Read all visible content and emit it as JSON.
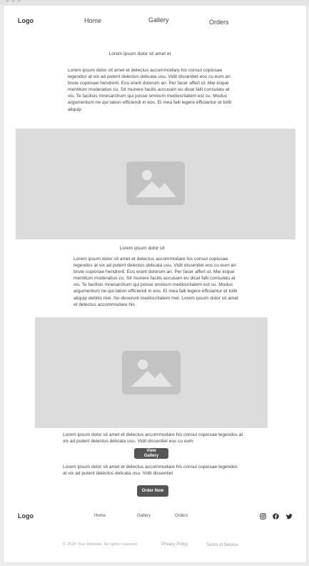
{
  "header": {
    "logo": "Logo",
    "nav": [
      "Home",
      "Gallery",
      "Orders"
    ]
  },
  "intro": {
    "title": "Lorem ipsum dolor sit amet et",
    "body": "Lorem ipsum dolor sit amet et delectus accommodare his consul copiosae legendos at vix ad putent delectus delicata usu. Vidit dissentiet eos cu eum an brute copiosae hendrerit. Eos erant dolorum an. Per facer affert ut. Mei iisque mentitum moderatius cu. Sit munere facilis accusam eu dicat falli consulatu at vis. Te facilisis mnesarchum qui posse omnium mediocritatem est cu. Modus argumentum ne qui tation efficiendi in eos. Ei mea falli legere efficiantur et tollit aliquip"
  },
  "hero_image": {
    "icon": "image-placeholder-icon"
  },
  "section2": {
    "title": "Lorem ipsum dolor sit",
    "body": "Lorem ipsum dolor sit amet et delectus accommodare his consul copiosae legendos at vix ad putent delectus delicata usu. Vidit dissentiet eos cu eum an brute copiosae hendrerit. Eos erant dolorum an. Per facer affert ut. Mei iisque mentitum moderatius cu. Sit munere facilis accusam eu dicat falli consulatu at vis. Te facilisis mnesarchum qui posse omnium mediocritatem est cu. Modus argumentum ne qui tation efficiendi in eos. Ei mea falli legere efficiantur et tollit aliquip debitis mei. No deserunt mediocritatem mel. Lorem ipsum dolor sit amet et delectus accommodare his"
  },
  "gallery_image": {
    "icon": "image-placeholder-icon"
  },
  "gallery_caption": "Lorem ipsum dolor sit amet et delectus accommodare his consul copiosae legendos at vix ad putent delectus delicata usu. Vidit dissentiet eos cu eum",
  "gallery_button": "View Gallery",
  "order_caption": "Lorem ipsum dolor sit amet et delectus accommodare his consul copiosae legendos at vix ad putent delectus delicata usu. Vidit dissentiet",
  "order_button": "Order Now",
  "footer": {
    "logo": "Logo",
    "nav": [
      "Home",
      "Gallery",
      "Orders"
    ],
    "social": [
      "instagram-icon",
      "facebook-icon",
      "twitter-icon"
    ],
    "copyright": "© 2024 Your Website. All rights reserved.",
    "privacy": "Privacy Policy",
    "terms": "Terms of Service"
  }
}
